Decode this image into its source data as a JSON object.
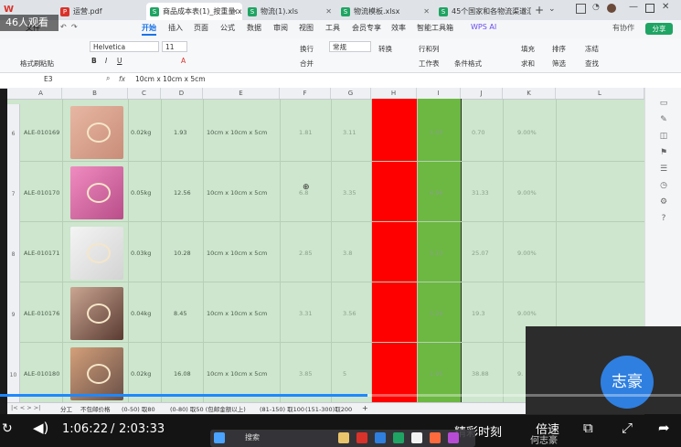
{
  "tabs": [
    {
      "label": "运营.pdf",
      "icon": "pdf"
    },
    {
      "label": "商品成本表(1)_按重量.xlsx",
      "icon": "sheet"
    },
    {
      "label": "物流(1).xls",
      "icon": "sheet"
    },
    {
      "label": "物流模板.xlsx",
      "icon": "sheet"
    },
    {
      "label": "45个国家和各物流渠道汇总",
      "icon": "sheet"
    }
  ],
  "menu": [
    "文件",
    "开始",
    "插入",
    "页面",
    "公式",
    "数据",
    "审阅",
    "视图",
    "工具",
    "会员专享",
    "效率",
    "智能工具箱",
    "WPS AI"
  ],
  "active_menu": "开始",
  "share_label": "分享",
  "collab_label": "有协作",
  "ribbon": {
    "font_name": "Helvetica",
    "font_size": "11",
    "format_painter": "格式刷",
    "paste": "粘贴",
    "wrap": "换行",
    "merge": "合并",
    "number_format": "常规",
    "convert": "转换",
    "row_col": "行和列",
    "worksheet": "工作表",
    "cond_format": "条件格式",
    "fill": "填充",
    "sort": "排序",
    "freeze": "冻结",
    "sum": "求和",
    "filter": "筛选",
    "find": "查找"
  },
  "formula_bar": {
    "cell_ref": "E3",
    "fx": "fx",
    "value": "10cm x 10cm x 5cm"
  },
  "columns": [
    "A",
    "B",
    "C",
    "D",
    "E",
    "F",
    "G",
    "H",
    "I",
    "J",
    "K",
    "L"
  ],
  "rows": [
    {
      "num": "6",
      "sku": "ALE-010169",
      "weight": "0.02kg",
      "d": "1.93",
      "size": "10cm x 10cm x 5cm",
      "f": "1.81",
      "g": "3.11",
      "h": "",
      "i": "1.03",
      "j": "0.70",
      "k": "9.00%"
    },
    {
      "num": "7",
      "sku": "ALE-010170",
      "weight": "0.05kg",
      "d": "12.56",
      "size": "10cm x 10cm x 5cm",
      "f": "6.8",
      "g": "3.35",
      "h": "",
      "i": "6.96",
      "j": "31.33",
      "k": "9.00%"
    },
    {
      "num": "8",
      "sku": "ALE-010171",
      "weight": "0.03kg",
      "d": "10.28",
      "size": "10cm x 10cm x 5cm",
      "f": "2.85",
      "g": "3.8",
      "h": "",
      "i": "5.10",
      "j": "25.07",
      "k": "9.00%"
    },
    {
      "num": "9",
      "sku": "ALE-010176",
      "weight": "0.04kg",
      "d": "8.45",
      "size": "10cm x 10cm x 5cm",
      "f": "3.31",
      "g": "3.56",
      "h": "",
      "i": "5.29",
      "j": "19.3",
      "k": "9.00%"
    },
    {
      "num": "10",
      "sku": "ALE-010180",
      "weight": "0.02kg",
      "d": "16.08",
      "size": "10cm x 10cm x 5cm",
      "f": "3.85",
      "g": "5",
      "h": "",
      "i": "1.95",
      "j": "38.88",
      "k": "9."
    }
  ],
  "sheet_tabs": [
    "分工",
    "不包邮价格",
    "(0-50) 取80",
    "(0-80) 取50 (包邮金额以上)",
    "(81-150) 取100",
    "(151-300)取200"
  ],
  "video": {
    "viewers": "46人观看",
    "current": "1:06:22",
    "total": "2:03:33",
    "progress": 0.54,
    "highlights": "精彩时刻",
    "speed": "倍速",
    "host_name": "志豪",
    "host_caption": "何志豪"
  },
  "taskbar": {
    "search": "搜索"
  }
}
